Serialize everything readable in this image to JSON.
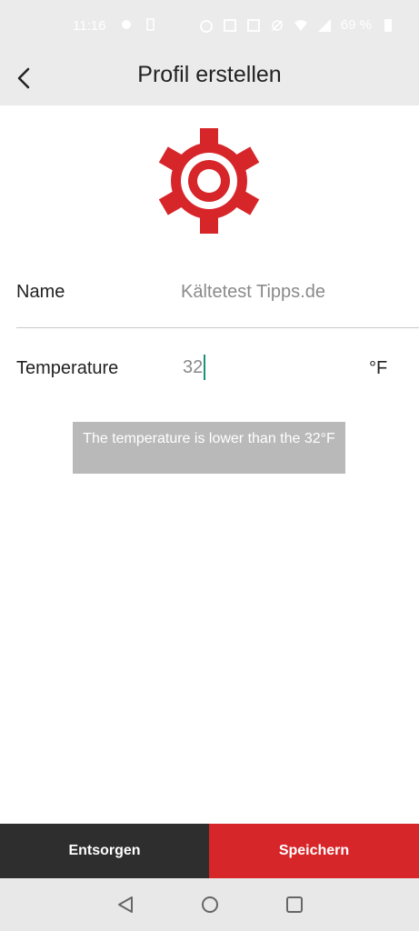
{
  "status_bar": {
    "time": "11:16",
    "battery": "69 %",
    "icons": [
      "notification-icon",
      "battery-saver-icon",
      "alarm-icon",
      "nfc-icon",
      "screenshot-icon",
      "do-not-disturb-icon",
      "wifi-icon",
      "signal-icon",
      "battery-icon"
    ]
  },
  "header": {
    "title": "Profil erstellen",
    "back_icon": "chevron-left-icon"
  },
  "logo": {
    "icon": "gear-icon",
    "color": "#d6262a"
  },
  "form": {
    "name_label": "Name",
    "name_placeholder": "Kältetest Tipps.de",
    "temperature_label": "Temperature",
    "temperature_value": "32",
    "temperature_unit": "°F"
  },
  "toast": {
    "message": "The temperature is lower than the 32°F"
  },
  "actions": {
    "discard_label": "Entsorgen",
    "save_label": "Speichern"
  },
  "colors": {
    "accent": "#d6262a",
    "dark": "#2e2e2e",
    "caret": "#1e8f7a",
    "toast_bg": "#b9b9b9"
  },
  "nav_bar": {
    "back": "triangle-back-icon",
    "home": "circle-home-icon",
    "recents": "square-recents-icon"
  }
}
